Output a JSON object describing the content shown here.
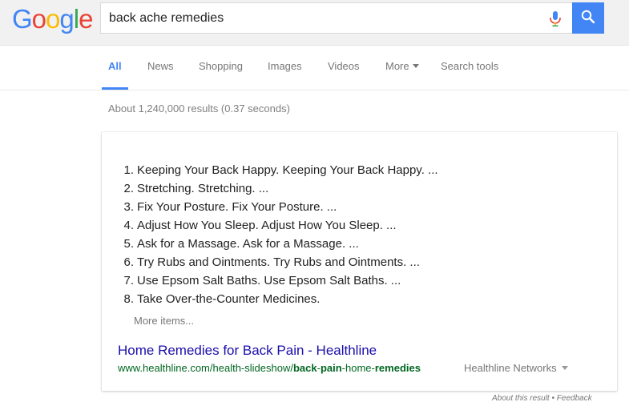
{
  "header": {
    "logo_letters": [
      {
        "ch": "G",
        "color": "#4285f4"
      },
      {
        "ch": "o",
        "color": "#ea4335"
      },
      {
        "ch": "o",
        "color": "#fbbc05"
      },
      {
        "ch": "g",
        "color": "#4285f4"
      },
      {
        "ch": "l",
        "color": "#34a853"
      },
      {
        "ch": "e",
        "color": "#ea4335"
      }
    ],
    "search_value": "back ache remedies",
    "mic_icon": "mic-icon",
    "search_icon": "search-icon",
    "accent": "#4285f4"
  },
  "tabs": [
    {
      "label": "All",
      "active": true
    },
    {
      "label": "News"
    },
    {
      "label": "Shopping"
    },
    {
      "label": "Images"
    },
    {
      "label": "Videos"
    },
    {
      "label": "More"
    },
    {
      "label": "Search tools"
    }
  ],
  "result_stats": "About 1,240,000 results (0.37 seconds)",
  "featured": {
    "items": [
      {
        "num": "1.",
        "text": "Keeping Your Back Happy. Keeping Your Back Happy. ..."
      },
      {
        "num": "2.",
        "text": "Stretching. Stretching. ..."
      },
      {
        "num": "3.",
        "text": "Fix Your Posture. Fix Your Posture. ..."
      },
      {
        "num": "4.",
        "text": "Adjust How You Sleep. Adjust How You Sleep. ..."
      },
      {
        "num": "5.",
        "text": "Ask for a Massage. Ask for a Massage. ..."
      },
      {
        "num": "6.",
        "text": "Try Rubs and Ointments. Try Rubs and Ointments. ..."
      },
      {
        "num": "7.",
        "text": "Use Epsom Salt Baths. Use Epsom Salt Baths. ..."
      },
      {
        "num": "8.",
        "text": "Take Over-the-Counter Medicines."
      }
    ],
    "more_items": "More items...",
    "title": "Home Remedies for Back Pain - Healthline",
    "url_plain": "www.healthline.com/health-slideshow/",
    "url_bold_1": "back",
    "url_sep_1": "-",
    "url_bold_2": "pain",
    "url_sep_2": "-home-",
    "url_bold_3": "remedies",
    "source": "Healthline Networks"
  },
  "footer": {
    "about": "About this result",
    "sep": " • ",
    "feedback": "Feedback"
  }
}
